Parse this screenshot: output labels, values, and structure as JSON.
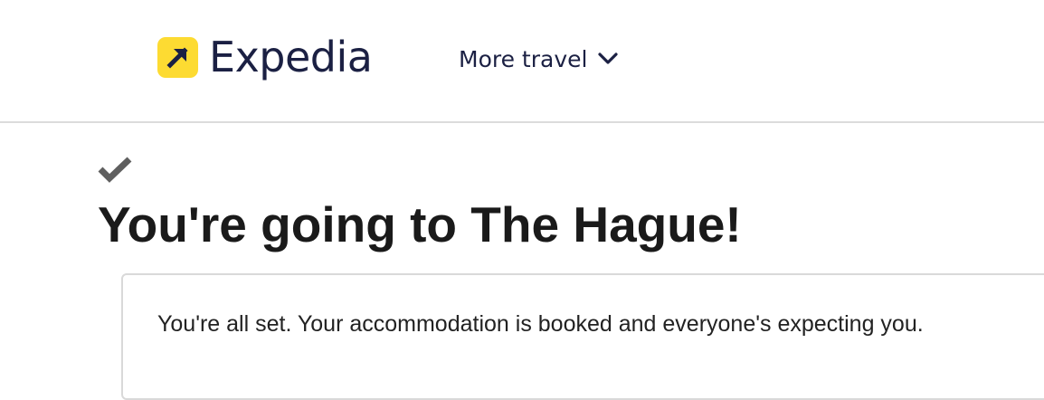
{
  "header": {
    "brand": "Expedia",
    "nav_label": "More travel",
    "brand_color": "#FDDB32",
    "text_color": "#1b2043",
    "logo_icon": "arrow-up-right-icon",
    "nav_icon": "chevron-down-icon"
  },
  "confirmation": {
    "icon": "checkmark-icon",
    "title": "You're going to The Hague!",
    "message": "You're all set. Your accommodation is booked and everyone's expecting you."
  }
}
